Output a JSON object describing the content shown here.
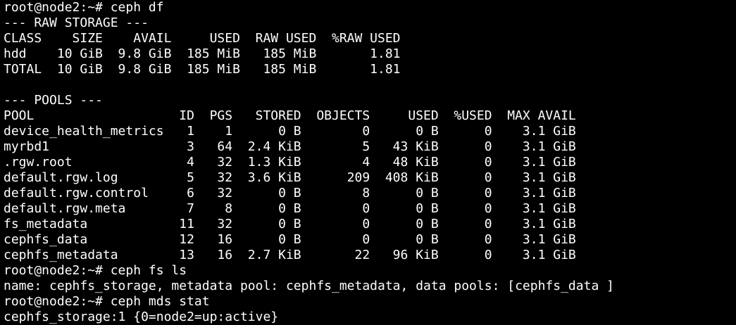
{
  "terminal": {
    "lines": [
      "root@node2:~# ceph df",
      "--- RAW STORAGE ---",
      "CLASS    SIZE    AVAIL     USED  RAW USED  %RAW USED",
      "hdd    10 GiB  9.8 GiB  185 MiB   185 MiB       1.81",
      "TOTAL  10 GiB  9.8 GiB  185 MiB   185 MiB       1.81",
      "",
      "--- POOLS ---",
      "POOL                   ID  PGS   STORED  OBJECTS     USED  %USED  MAX AVAIL",
      "device_health_metrics   1    1      0 B        0      0 B      0    3.1 GiB",
      "myrbd1                  3   64  2.4 KiB        5   43 KiB      0    3.1 GiB",
      ".rgw.root               4   32  1.3 KiB        4   48 KiB      0    3.1 GiB",
      "default.rgw.log         5   32  3.6 KiB      209  408 KiB      0    3.1 GiB",
      "default.rgw.control     6   32      0 B        8      0 B      0    3.1 GiB",
      "default.rgw.meta        7    8      0 B        0      0 B      0    3.1 GiB",
      "fs_metadata            11   32      0 B        0      0 B      0    3.1 GiB",
      "cephfs_data            12   16      0 B        0      0 B      0    3.1 GiB",
      "cephfs_metadata        13   16  2.7 KiB       22   96 KiB      0    3.1 GiB",
      "root@node2:~# ceph fs ls",
      "name: cephfs_storage, metadata pool: cephfs_metadata, data pools: [cephfs_data ]",
      "root@node2:~# ceph mds stat",
      "cephfs_storage:1 {0=node2=up:active}"
    ]
  }
}
